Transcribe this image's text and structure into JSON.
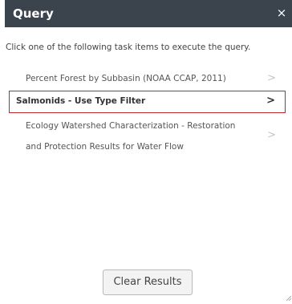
{
  "panel": {
    "title": "Query",
    "close_glyph": "×",
    "instruction": "Click one of the following task items to execute the query."
  },
  "tasks": [
    {
      "label": "Percent Forest by Subbasin (NOAA CCAP, 2011)",
      "selected": false
    },
    {
      "label": "Salmonids - Use Type Filter",
      "selected": true
    },
    {
      "label_line1": "Ecology Watershed Characterization - Restoration",
      "label_line2": "and Protection Results for Water Flow",
      "selected": false
    }
  ],
  "chevron_glyph": ">",
  "actions": {
    "clear_results_label": "Clear Results"
  },
  "colors": {
    "header_bg": "#3b434d",
    "selected_border": "#c0282d"
  },
  "icons": {
    "close": "close-icon",
    "chevron": "chevron-right-icon",
    "resize": "resize-grip-icon"
  }
}
